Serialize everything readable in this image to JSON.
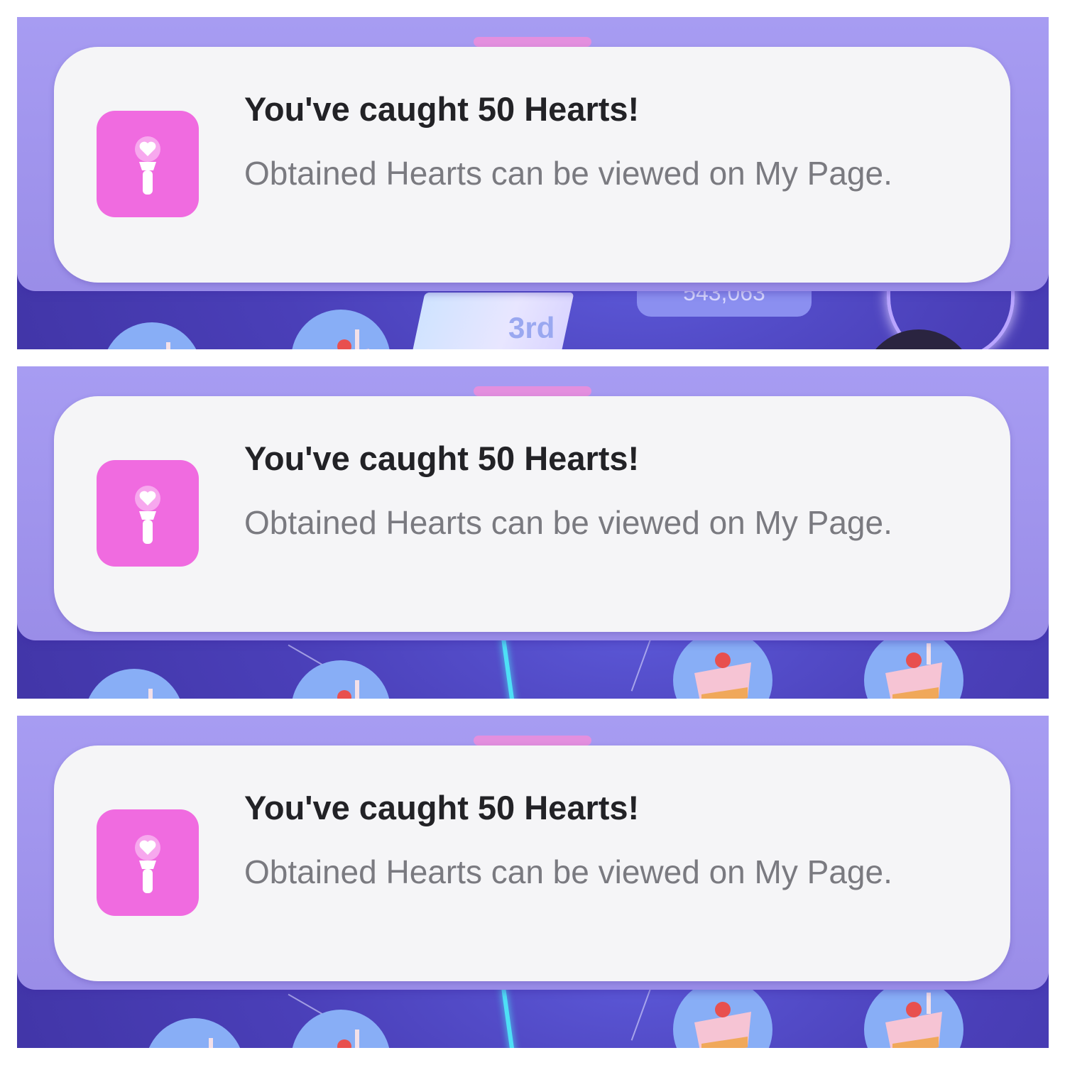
{
  "notifications": [
    {
      "title": "You've caught 50 Hearts!",
      "body": "Obtained Hearts can be viewed on My Page.",
      "icon": "lightstick-heart-icon",
      "background": {
        "rank_label": "3rd",
        "score_text": "543,063"
      }
    },
    {
      "title": "You've caught 50 Hearts!",
      "body": "Obtained Hearts can be viewed on My Page.",
      "icon": "lightstick-heart-icon"
    },
    {
      "title": "You've caught 50 Hearts!",
      "body": "Obtained Hearts can be viewed on My Page.",
      "icon": "lightstick-heart-icon"
    }
  ],
  "colors": {
    "banner": "#9a8de8",
    "card": "#f5f5f7",
    "app_icon": "#f06be0",
    "handle": "#e38fde",
    "title_text": "#222226",
    "body_text": "#7a7a80"
  }
}
